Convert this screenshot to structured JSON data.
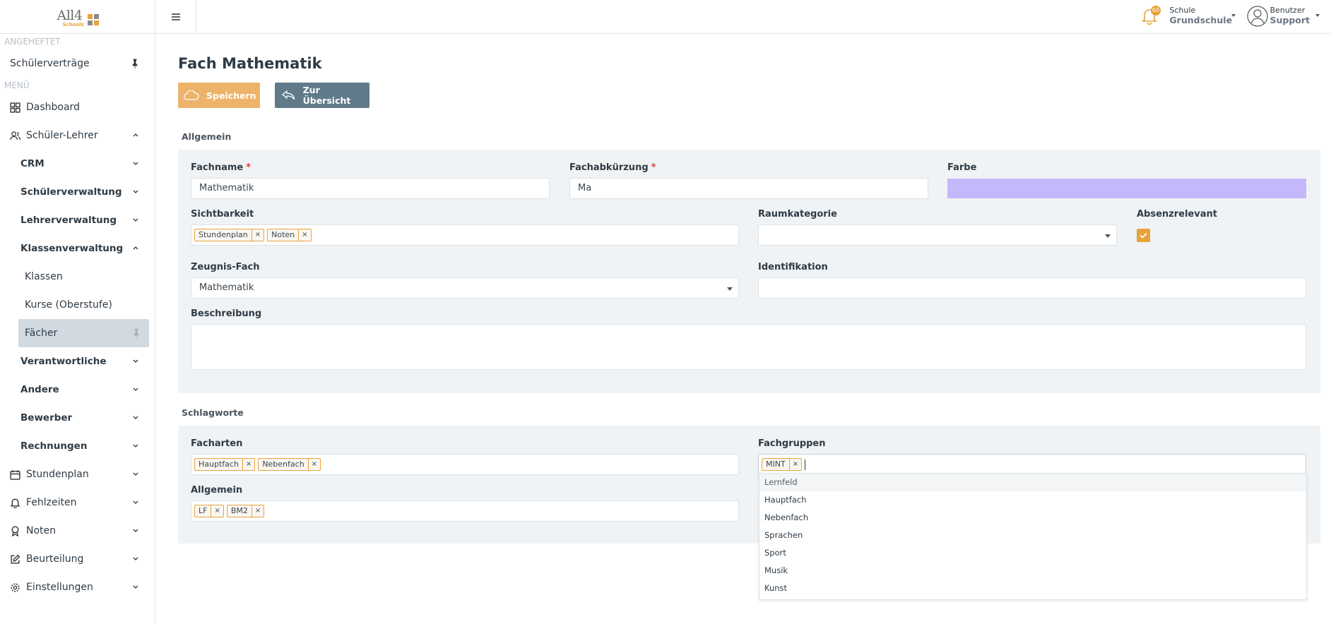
{
  "app": {
    "logo_text": "All4",
    "logo_sub": "Schools"
  },
  "sidebar": {
    "pinned_label": "ANGEHEFTET",
    "pinned_item": "Schülerverträge",
    "menu_label": "MENÜ",
    "items": {
      "dashboard": "Dashboard",
      "schueler_lehrer": "Schüler-Lehrer",
      "crm": "CRM",
      "schuelerverwaltung": "Schülerverwaltung",
      "lehrerverwaltung": "Lehrerverwaltung",
      "klassenverwaltung": "Klassenverwaltung",
      "klassen": "Klassen",
      "kurse": "Kurse (Oberstufe)",
      "faecher": "Fächer",
      "verantwortliche": "Verantwortliche",
      "andere": "Andere",
      "bewerber": "Bewerber",
      "rechnungen": "Rechnungen",
      "stundenplan": "Stundenplan",
      "fehlzeiten": "Fehlzeiten",
      "noten": "Noten",
      "beurteilung": "Beurteilung",
      "einstellungen": "Einstellungen"
    }
  },
  "topbar": {
    "notification_count": "60",
    "school_label": "Schule",
    "school_value": "Grundschule",
    "user_label": "Benutzer",
    "user_value": "Support"
  },
  "page": {
    "title": "Fach Mathematik",
    "save_label": "Speichern",
    "back_label": "Zur Übersicht"
  },
  "general": {
    "section_title": "Allgemein",
    "fachname_label": "Fachname",
    "fachname_value": "Mathematik",
    "kuerzel_label": "Fachabkürzung",
    "kuerzel_value": "Ma",
    "farbe_label": "Farbe",
    "farbe_value": "#c5b7fb",
    "sichtbarkeit_label": "Sichtbarkeit",
    "sichtbarkeit_tags": [
      "Stundenplan",
      "Noten"
    ],
    "raumkategorie_label": "Raumkategorie",
    "absenz_label": "Absenzrelevant",
    "zeugnis_label": "Zeugnis-Fach",
    "zeugnis_value": "Mathematik",
    "identifikation_label": "Identifikation",
    "beschreibung_label": "Beschreibung",
    "required_mark": "*"
  },
  "keywords": {
    "section_title": "Schlagworte",
    "facharten_label": "Facharten",
    "facharten_tags": [
      "Hauptfach",
      "Nebenfach"
    ],
    "fachgruppen_label": "Fachgruppen",
    "fachgruppen_tags": [
      "MINT"
    ],
    "allgemein_label": "Allgemein",
    "allgemein_tags": [
      "LF",
      "BM2"
    ],
    "dropdown_options": [
      "Lernfeld",
      "Hauptfach",
      "Nebenfach",
      "Sprachen",
      "Sport",
      "Musik",
      "Kunst"
    ]
  },
  "tag_remove": "×",
  "colors": {
    "accent": "#e8a23b",
    "save_button": "#edb36a",
    "back_button": "#607a89",
    "panel": "#f0f3f5"
  }
}
